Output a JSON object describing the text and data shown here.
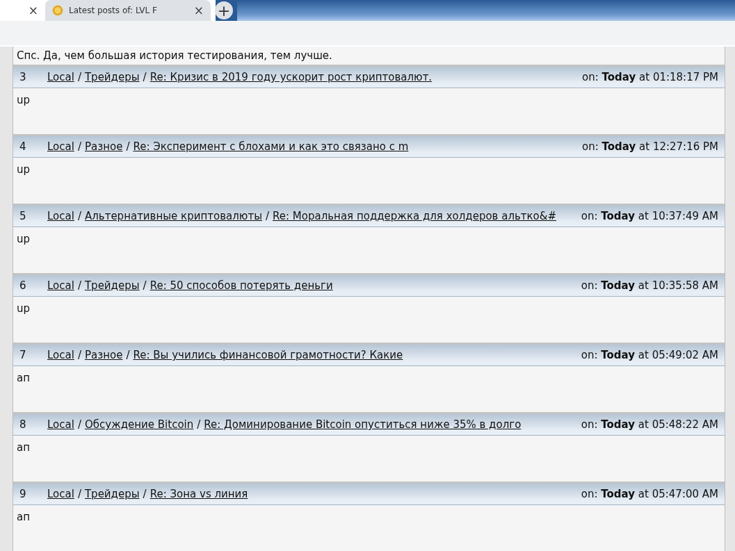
{
  "browser": {
    "tabs": [
      {
        "selected": false,
        "close": "×"
      },
      {
        "title": "Latest posts of: LVL F",
        "selected": true,
        "close": "×"
      }
    ],
    "new_tab": "+"
  },
  "first_post_text": "Спс. Да, чем большая история тестирования, тем лучше.",
  "posts": [
    {
      "number": "3",
      "crumbs": [
        {
          "kind": "link",
          "text": "Local"
        },
        {
          "kind": "sep",
          "text": "/"
        },
        {
          "kind": "link",
          "text": "Трейдеры"
        },
        {
          "kind": "sep",
          "text": "/"
        },
        {
          "kind": "link",
          "text": "Re: Кризис в 2019 году ускорит рост криптовалют."
        }
      ],
      "date": "on: **Today** at 01:18:17 PM",
      "body": "up"
    },
    {
      "number": "4",
      "crumbs": [
        {
          "kind": "link",
          "text": "Local"
        },
        {
          "kind": "sep",
          "text": "/"
        },
        {
          "kind": "link",
          "text": "Разное"
        },
        {
          "kind": "sep",
          "text": "/"
        },
        {
          "kind": "link",
          "text": "Re: Эксперимент с блохами и как это связано с m"
        }
      ],
      "date": "on: **Today** at 12:27:16 PM",
      "body": "up"
    },
    {
      "number": "5",
      "crumbs": [
        {
          "kind": "link",
          "text": "Local"
        },
        {
          "kind": "sep",
          "text": "/"
        },
        {
          "kind": "link",
          "text": "Альтернативные криптовалюты"
        },
        {
          "kind": "sep",
          "text": "/"
        },
        {
          "kind": "link",
          "text": "Re: Моральная поддержка для холдеров альтко&#"
        }
      ],
      "date": "on: **Today** at 10:37:49 AM",
      "body": "up"
    },
    {
      "number": "6",
      "crumbs": [
        {
          "kind": "link",
          "text": "Local"
        },
        {
          "kind": "sep",
          "text": "/"
        },
        {
          "kind": "link",
          "text": "Трейдеры"
        },
        {
          "kind": "sep",
          "text": "/"
        },
        {
          "kind": "link",
          "text": "Re: 50 способов потерять деньги"
        }
      ],
      "date": "on: **Today** at 10:35:58 AM",
      "body": "up"
    },
    {
      "number": "7",
      "crumbs": [
        {
          "kind": "link",
          "text": "Local"
        },
        {
          "kind": "sep",
          "text": "/"
        },
        {
          "kind": "link",
          "text": "Разное"
        },
        {
          "kind": "sep",
          "text": "/"
        },
        {
          "kind": "link",
          "text": "Re: Вы учились финансовой грамотности? Какие"
        }
      ],
      "date": "on: **Today** at 05:49:02 AM",
      "body": "ап"
    },
    {
      "number": "8",
      "crumbs": [
        {
          "kind": "link",
          "text": "Local"
        },
        {
          "kind": "sep",
          "text": "/"
        },
        {
          "kind": "link",
          "text": "Обсуждение Bitcoin"
        },
        {
          "kind": "sep",
          "text": "/"
        },
        {
          "kind": "link",
          "text": "Re: Доминирование Bitcoin опуститься ниже 35% в долго"
        }
      ],
      "date": "on: **Today** at 05:48:22 AM",
      "body": "ап"
    },
    {
      "number": "9",
      "crumbs": [
        {
          "kind": "link",
          "text": "Local"
        },
        {
          "kind": "sep",
          "text": "/"
        },
        {
          "kind": "link",
          "text": "Трейдеры"
        },
        {
          "kind": "sep",
          "text": "/"
        },
        {
          "kind": "link",
          "text": "Re: Зона vs линия"
        }
      ],
      "date": "on: **Today** at 05:47:00 AM",
      "body": "ап"
    }
  ]
}
